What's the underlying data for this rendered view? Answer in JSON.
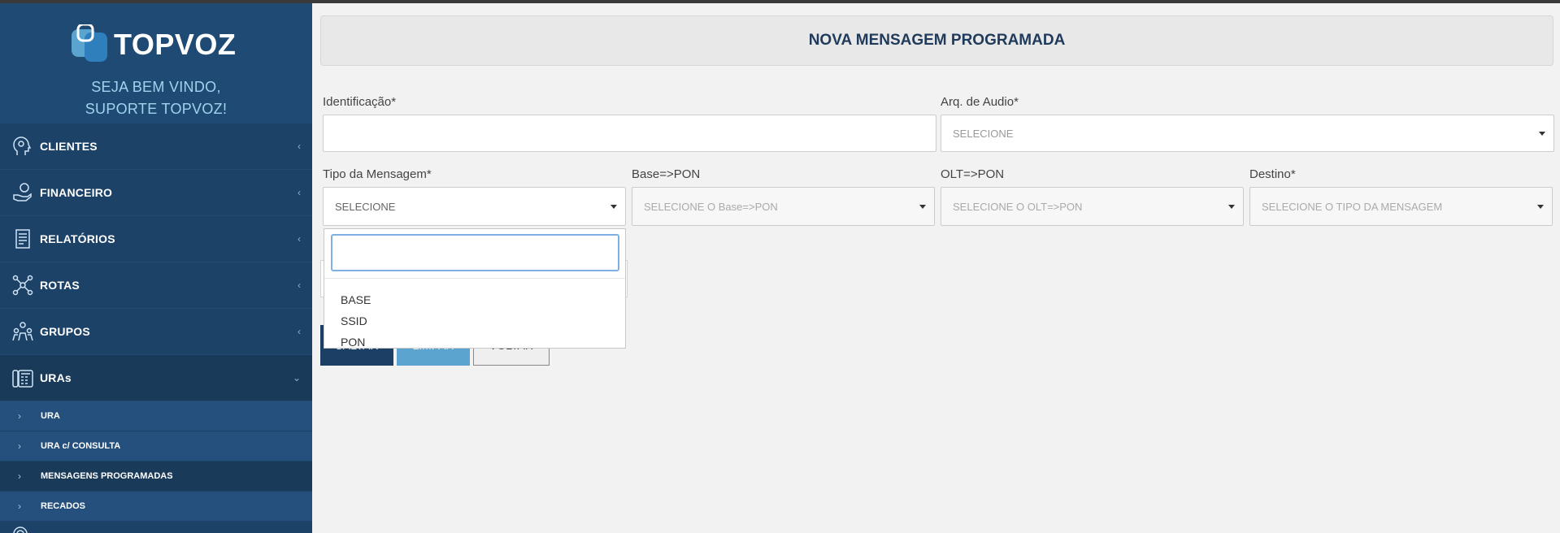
{
  "brand": {
    "name": "TOPVOZ",
    "welcome_line1": "SEJA BEM VINDO,",
    "welcome_line2": "SUPORTE TOPVOZ!"
  },
  "sidebar": {
    "items": [
      {
        "label": "CLIENTES",
        "icon": "head-gear-icon"
      },
      {
        "label": "FINANCEIRO",
        "icon": "hand-money-icon"
      },
      {
        "label": "RELATÓRIOS",
        "icon": "report-icon"
      },
      {
        "label": "ROTAS",
        "icon": "network-icon"
      },
      {
        "label": "GRUPOS",
        "icon": "group-icon"
      },
      {
        "label": "URAs",
        "icon": "phone-system-icon"
      }
    ],
    "submenu": [
      {
        "label": "URA"
      },
      {
        "label": "URA c/ CONSULTA"
      },
      {
        "label": "MENSAGENS PROGRAMADAS"
      },
      {
        "label": "RECADOS"
      }
    ]
  },
  "page": {
    "title": "NOVA MENSAGEM PROGRAMADA"
  },
  "form": {
    "identificacao_label": "Identificação*",
    "identificacao_value": "",
    "audio_label": "Arq. de Audio*",
    "audio_value": "SELECIONE",
    "tipo_label": "Tipo da Mensagem*",
    "tipo_value": "SELECIONE",
    "base_label": "Base=>PON",
    "base_value": "SELECIONE O Base=>PON",
    "olt_label": "OLT=>PON",
    "olt_value": "SELECIONE O OLT=>PON",
    "destino_label": "Destino*",
    "destino_value": "SELECIONE O TIPO DA MENSAGEM"
  },
  "buttons": {
    "save": "SALVAR",
    "clear": "LIMPAR",
    "back": "VOLTAR"
  },
  "dropdown": {
    "search_value": "",
    "options": [
      "BASE",
      "SSID",
      "PON"
    ]
  },
  "colors": {
    "sidebar": "#1c4267",
    "accent": "#5ba4d0",
    "primary": "#1c3f66"
  }
}
